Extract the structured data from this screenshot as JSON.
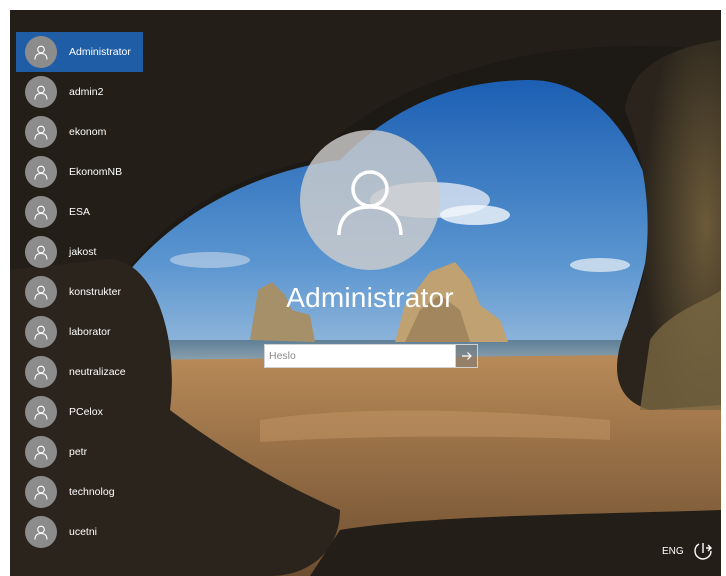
{
  "users": [
    {
      "label": "Administrator",
      "selected": true
    },
    {
      "label": "admin2"
    },
    {
      "label": "ekonom"
    },
    {
      "label": "EkonomNB"
    },
    {
      "label": "ESA"
    },
    {
      "label": "jakost"
    },
    {
      "label": "konstrukter"
    },
    {
      "label": "laborator"
    },
    {
      "label": "neutralizace"
    },
    {
      "label": "PCelox"
    },
    {
      "label": "petr"
    },
    {
      "label": "technolog"
    },
    {
      "label": "ucetni"
    }
  ],
  "login": {
    "user_name": "Administrator",
    "password_placeholder": "Heslo"
  },
  "footer": {
    "language": "ENG"
  },
  "icons": {
    "avatar": "user-icon",
    "submit": "arrow-right-icon",
    "accessibility": "ease-of-access-icon"
  },
  "colors": {
    "selected": "#1f5ea6",
    "avatar_bg": "#8c8c8c"
  }
}
